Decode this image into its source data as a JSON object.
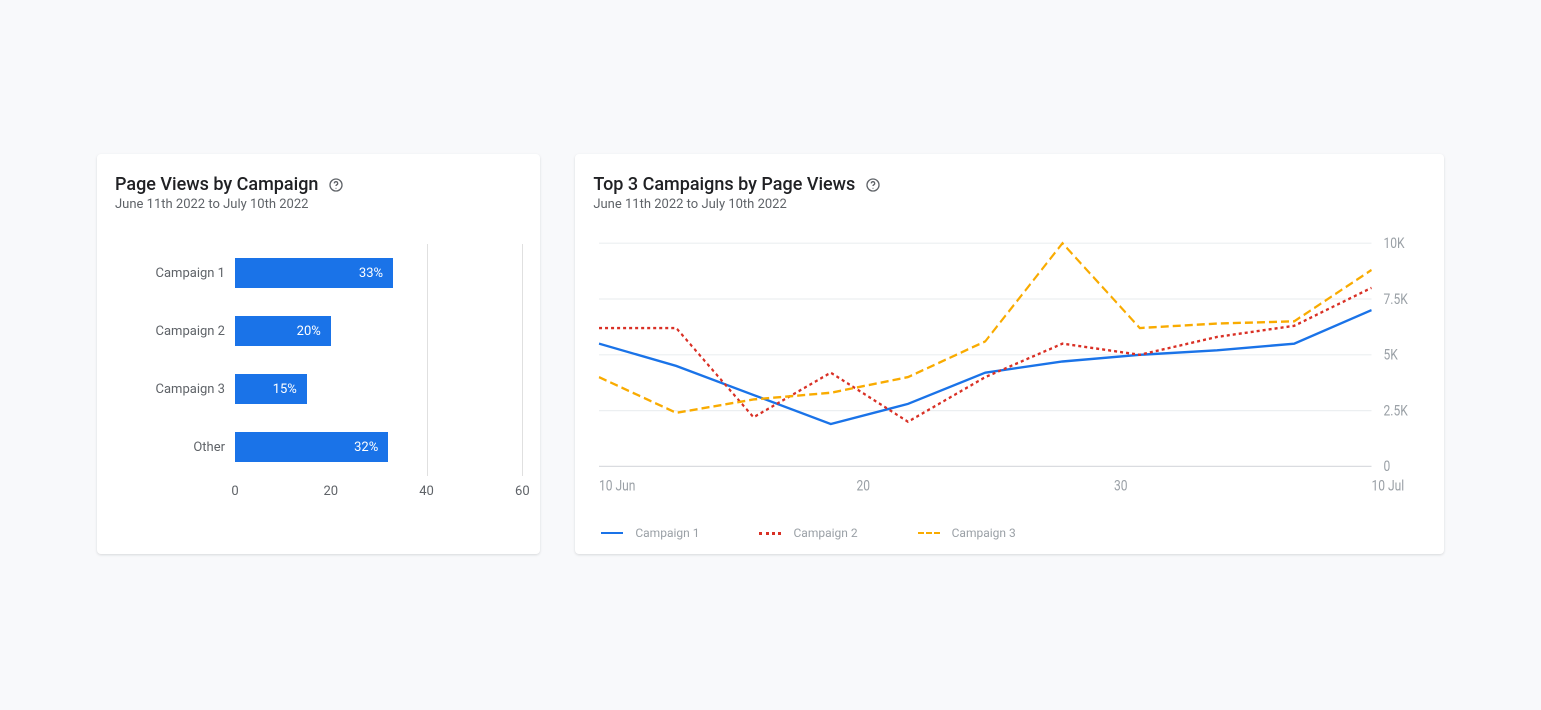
{
  "left_card": {
    "title": "Page Views by Campaign",
    "subtitle": "June 11th 2022 to July 10th 2022",
    "help_icon": "help-circle-icon"
  },
  "right_card": {
    "title": "Top 3 Campaigns by Page Views",
    "subtitle": "June 11th 2022 to July 10th 2022",
    "help_icon": "help-circle-icon"
  },
  "chart_data": [
    {
      "type": "bar",
      "orientation": "horizontal",
      "title": "Page Views by Campaign",
      "xlabel": "",
      "ylabel": "",
      "xlim": [
        0,
        60
      ],
      "x_ticks": [
        0,
        20,
        40,
        60
      ],
      "categories": [
        "Campaign 1",
        "Campaign 2",
        "Campaign 3",
        "Other"
      ],
      "values": [
        33,
        20,
        15,
        32
      ],
      "value_labels": [
        "33%",
        "20%",
        "15%",
        "32%"
      ],
      "bar_color": "#1a73e8"
    },
    {
      "type": "line",
      "title": "Top 3 Campaigns by Page Views",
      "xlabel": "",
      "ylabel": "",
      "ylim": [
        0,
        10000
      ],
      "y_ticks": [
        0,
        2500,
        5000,
        7500,
        10000
      ],
      "y_tick_labels": [
        "0",
        "2.5K",
        "5K",
        "7.5K",
        "10K"
      ],
      "x": [
        10,
        13,
        16,
        19,
        22,
        25,
        28,
        31,
        34,
        37,
        40
      ],
      "x_tick_positions": [
        10,
        20,
        30,
        40
      ],
      "x_tick_labels": [
        "10 Jun",
        "20",
        "30",
        "10 Jul"
      ],
      "series": [
        {
          "name": "Campaign 1",
          "color": "#1a73e8",
          "style": "solid",
          "values": [
            5500,
            4500,
            3200,
            1900,
            2800,
            4200,
            4700,
            5000,
            5200,
            5500,
            7000
          ]
        },
        {
          "name": "Campaign 2",
          "color": "#d93025",
          "style": "dotted",
          "values": [
            6200,
            6200,
            2200,
            4200,
            2000,
            4000,
            5500,
            5000,
            5800,
            6300,
            8000
          ]
        },
        {
          "name": "Campaign 3",
          "color": "#f9ab00",
          "style": "dashed",
          "values": [
            4000,
            2400,
            3000,
            3300,
            4000,
            5600,
            10000,
            6200,
            6400,
            6500,
            8800
          ]
        }
      ],
      "legend": [
        "Campaign 1",
        "Campaign 2",
        "Campaign 3"
      ]
    }
  ]
}
